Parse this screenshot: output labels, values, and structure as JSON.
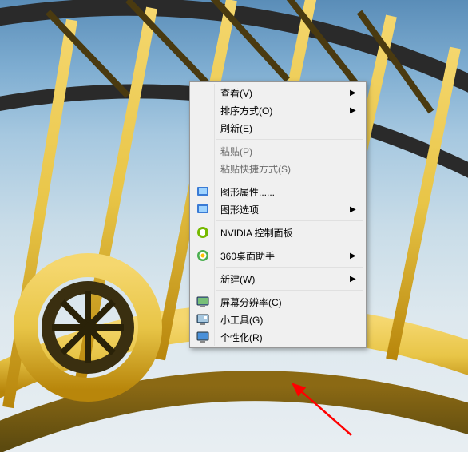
{
  "menu": {
    "view": "查看(V)",
    "sort": "排序方式(O)",
    "refresh": "刷新(E)",
    "paste": "粘贴(P)",
    "pasteShortcut": "粘贴快捷方式(S)",
    "gfxProps": "图形属性......",
    "gfxOptions": "图形选项",
    "nvidia": "NVIDIA 控制面板",
    "desk360": "360桌面助手",
    "new": "新建(W)",
    "resolution": "屏幕分辨率(C)",
    "gadgets": "小工具(G)",
    "personalize": "个性化(R)"
  }
}
